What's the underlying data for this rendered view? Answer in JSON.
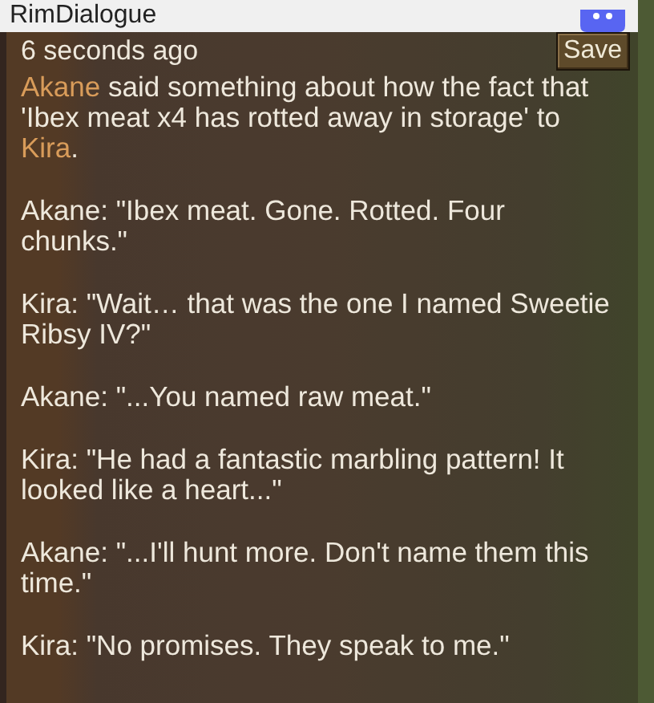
{
  "window": {
    "title": "RimDialogue"
  },
  "timestamp": "6 seconds ago",
  "save_button": "Save",
  "summary": {
    "speaker": "Akane",
    "middle": " said something about how the fact that 'Ibex meat x4 has rotted away in storage' to ",
    "target": "Kira",
    "end": "."
  },
  "lines": [
    "Akane: \"Ibex meat. Gone. Rotted. Four chunks.\"",
    "Kira: \"Wait… that was the one I named Sweetie Ribsy IV?\"",
    "Akane: \"...You named raw meat.\"",
    "Kira: \"He had a fantastic marbling pattern! It looked like a heart...\"",
    "Akane: \"...I'll hunt more. Don't name them this time.\"",
    "Kira: \"No promises. They speak to me.\""
  ]
}
